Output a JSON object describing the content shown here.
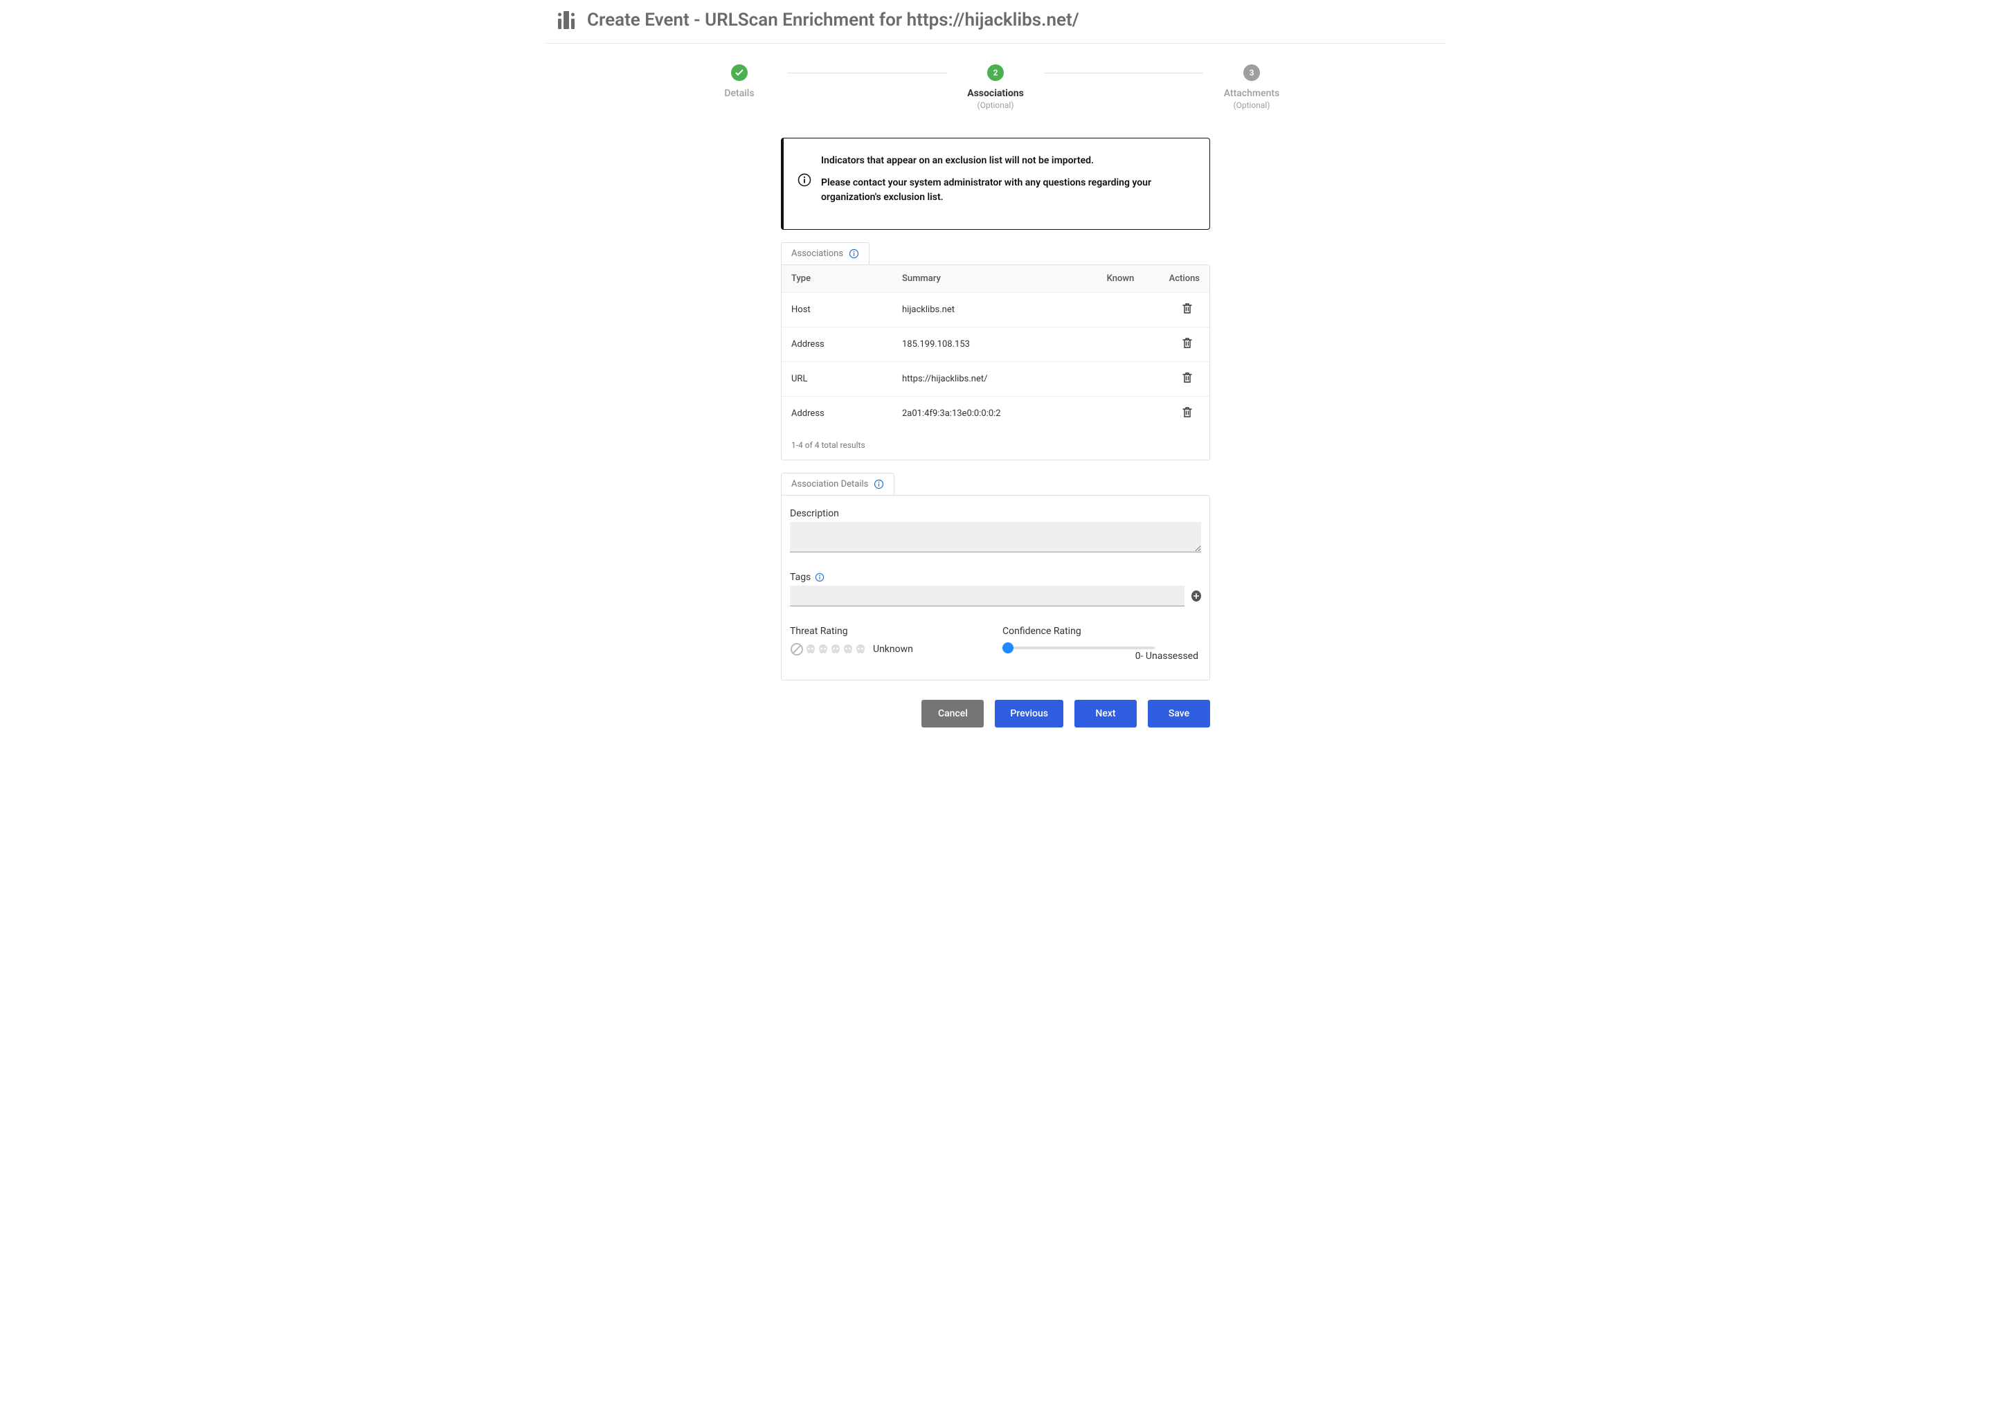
{
  "header": {
    "title": "Create Event - URLScan Enrichment for https://hijacklibs.net/"
  },
  "stepper": {
    "step1": {
      "label": "Details"
    },
    "step2": {
      "num": "2",
      "label": "Associations",
      "sub": "(Optional)"
    },
    "step3": {
      "num": "3",
      "label": "Attachments",
      "sub": "(Optional)"
    }
  },
  "infobox": {
    "line1": "Indicators that appear on an exclusion list will not be imported.",
    "line2": "Please contact your system administrator with any questions regarding your organization's exclusion list."
  },
  "tab_assoc": "Associations",
  "table": {
    "head": {
      "type": "Type",
      "summary": "Summary",
      "known": "Known",
      "actions": "Actions"
    },
    "rows": [
      {
        "type": "Host",
        "summary": "hijacklibs.net"
      },
      {
        "type": "Address",
        "summary": "185.199.108.153"
      },
      {
        "type": "URL",
        "summary": "https://hijacklibs.net/"
      },
      {
        "type": "Address",
        "summary": "2a01:4f9:3a:13e0:0:0:0:2"
      }
    ],
    "pager": "1-4 of 4 total results"
  },
  "tab_details": "Association Details",
  "details": {
    "desc_label": "Description",
    "tags_label": "Tags",
    "threat_label": "Threat Rating",
    "threat_value": "Unknown",
    "conf_label": "Confidence Rating",
    "conf_value": "0- Unassessed"
  },
  "buttons": {
    "cancel": "Cancel",
    "prev": "Previous",
    "next": "Next",
    "save": "Save"
  }
}
